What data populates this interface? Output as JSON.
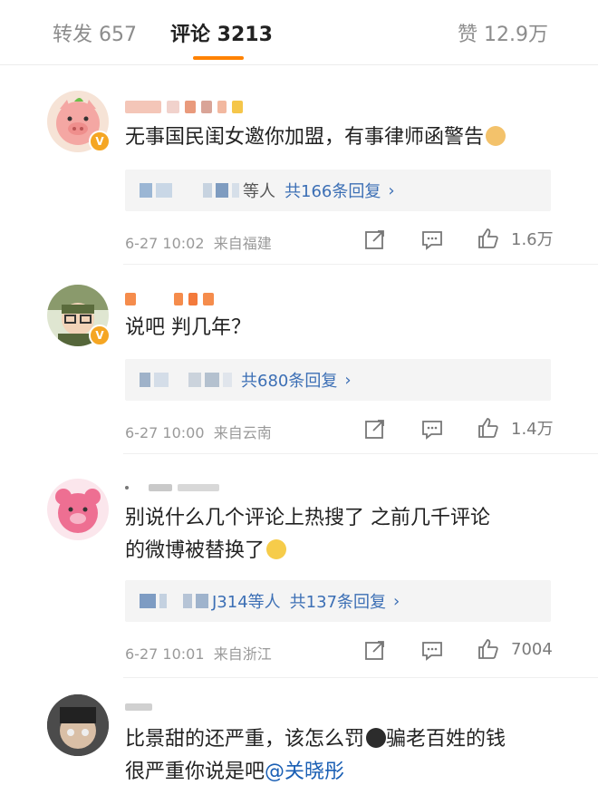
{
  "tabs": {
    "repost": "转发 657",
    "comments": "评论 3213",
    "likes": "赞 12.9万"
  },
  "colors": {
    "accent": "#ff8200",
    "link": "#3c6fb5",
    "badge": "#f5a623"
  },
  "comments": [
    {
      "text": "无事国民闺女邀你加盟，有事律师函警告",
      "emoji": "doge-emoji",
      "replies_names_suffix": "等人",
      "replies_count": "共166条回复",
      "time": "6-27 10:02",
      "location": "来自福建",
      "likes": "1.6万"
    },
    {
      "text": "说吧 判几年？",
      "replies_names_suffix": "",
      "replies_count": "共680条回复",
      "time": "6-27 10:00",
      "location": "来自云南",
      "likes": "1.4万"
    },
    {
      "text_line1": "别说什么几个评论上热搜了 之前几千评论",
      "text_line2": "的微博被替换了",
      "emoji": "smile-emoji",
      "replies_names_suffix": "J314等人",
      "replies_count": "共137条回复",
      "time": "6-27 10:01",
      "location": "来自浙江",
      "likes": "7004"
    },
    {
      "text_line1_a": "比景甜的还严重，该怎么罚",
      "text_line1_b": "骗老百姓的钱",
      "text_line2": "很严重你说是吧",
      "mention": "@关晓彤"
    }
  ],
  "chevron": "›"
}
